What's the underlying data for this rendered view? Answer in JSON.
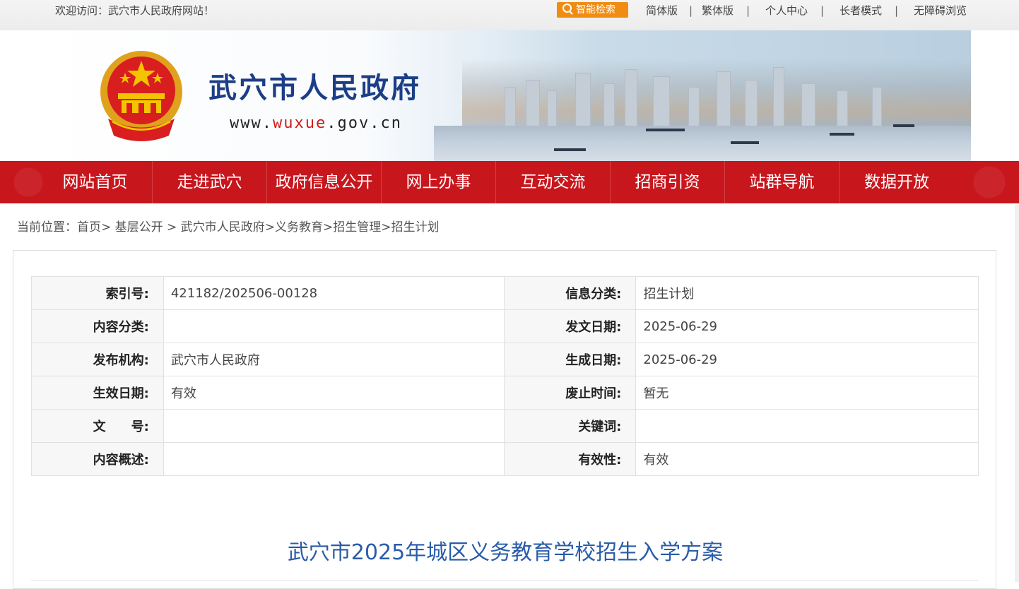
{
  "topbar": {
    "welcome": "欢迎访问：武穴市人民政府网站！",
    "search_label": "智能检索",
    "links": [
      "简体版",
      "繁体版",
      "个人中心",
      "长者模式",
      "无障碍浏览"
    ],
    "separator": "|"
  },
  "banner": {
    "title": "武穴市人民政府",
    "url_prefix": "www.",
    "url_accent": "wuxue",
    "url_suffix": ".gov.cn"
  },
  "nav": {
    "items": [
      "网站首页",
      "走进武穴",
      "政府信息公开",
      "网上办事",
      "互动交流",
      "招商引资",
      "站群导航",
      "数据开放"
    ]
  },
  "breadcrumb": {
    "prefix": "当前位置：",
    "items": [
      "首页",
      "基层公开",
      "武穴市人民政府",
      "义务教育",
      "招生管理",
      "招生计划"
    ],
    "sep_a": ">",
    "sep_b": " > "
  },
  "meta": {
    "rows": [
      {
        "l1": "索引号:",
        "v1": "421182/202506-00128",
        "l2": "信息分类:",
        "v2": "招生计划"
      },
      {
        "l1": "内容分类:",
        "v1": "",
        "l2": "发文日期:",
        "v2": "2025-06-29"
      },
      {
        "l1": "发布机构:",
        "v1": "武穴市人民政府",
        "l2": "生成日期:",
        "v2": "2025-06-29"
      },
      {
        "l1": "生效日期:",
        "v1": "有效",
        "l2": "废止时间:",
        "v2": "暂无"
      },
      {
        "l1": "文　　号:",
        "v1": "",
        "l2": "关键词:",
        "v2": ""
      },
      {
        "l1": "内容概述:",
        "v1": "",
        "l2": "有效性:",
        "v2": "有效"
      }
    ]
  },
  "document": {
    "title": "武穴市2025年城区义务教育学校招生入学方案"
  },
  "colors": {
    "nav_red": "#c8161d",
    "search_orange": "#f08c12",
    "title_blue": "#2a5ca8",
    "banner_title": "#1c3e86"
  }
}
